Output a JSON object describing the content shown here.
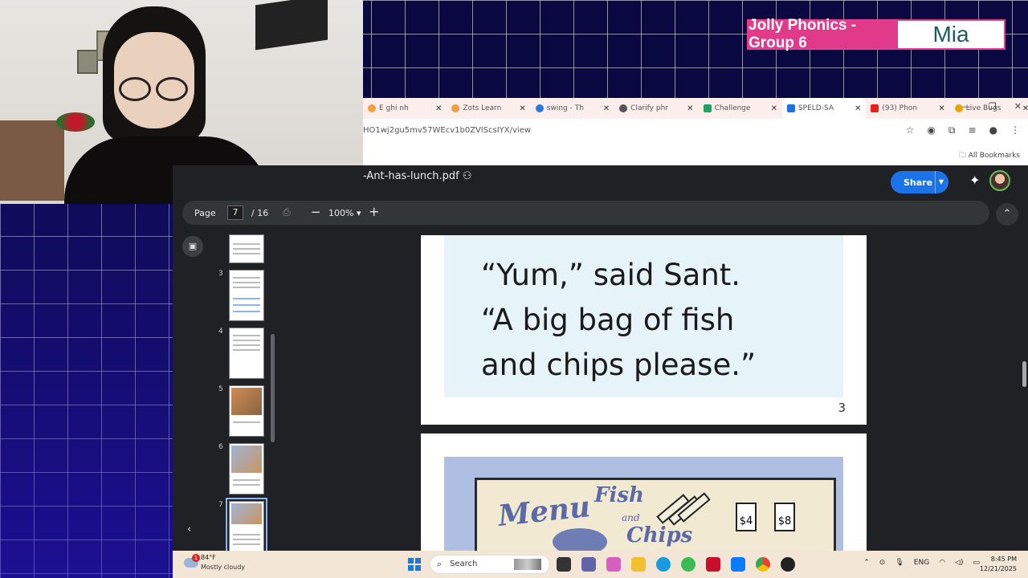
{
  "overlay": {
    "group": "Jolly Phonics - Group 6",
    "name": "Mia"
  },
  "browser": {
    "tabs": [
      {
        "label": "Ê ghi nh",
        "icon": "file-icon",
        "color": "#f0a040"
      },
      {
        "label": "Zots Learn",
        "icon": "zots-icon",
        "color": "#f0a040"
      },
      {
        "label": "swing - Th",
        "icon": "check-icon",
        "color": "#2a7ade"
      },
      {
        "label": "Clarify phr",
        "icon": "chatgpt-icon",
        "color": "#555555"
      },
      {
        "label": "Challenge",
        "icon": "sheets-icon",
        "color": "#1ea362"
      },
      {
        "label": "SPELD-SA",
        "icon": "drive-icon",
        "color": "#1a73e8",
        "active": true
      },
      {
        "label": "(93) Phon",
        "icon": "youtube-icon",
        "color": "#e62117"
      },
      {
        "label": "Live Bugs",
        "icon": "ublock-icon",
        "color": "#e8a400"
      }
    ],
    "url": "HO1wj2gu5mv57WEcv1b0ZVlScsIYX/view",
    "bookmarks_label": "All Bookmarks"
  },
  "viewer": {
    "file_name": "-Ant-has-lunch.pdf",
    "share_label": "Share",
    "page_label": "Page",
    "page_current": "7",
    "page_total": "/ 16",
    "zoom": "100%",
    "thumbnails": [
      {
        "num": "3"
      },
      {
        "num": "4"
      },
      {
        "num": "5"
      },
      {
        "num": "6"
      },
      {
        "num": "7",
        "active": true
      }
    ],
    "page_text_line1": "“Yum,” said Sant.",
    "page_text_line2": "“A big bag of fish",
    "page_text_line3": "and chips please.”",
    "page_number": "3",
    "menu_title": "Menu",
    "menu_fish": "Fish",
    "menu_and": "and",
    "menu_chips": "Chips",
    "price_1": "$4",
    "price_2": "$8"
  },
  "taskbar": {
    "weather_temp": "84°F",
    "weather_desc": "Mostly cloudy",
    "weather_badge": "1",
    "search_label": "Search",
    "language": "ENG",
    "time": "8:45 PM",
    "date": "12/21/2025"
  }
}
